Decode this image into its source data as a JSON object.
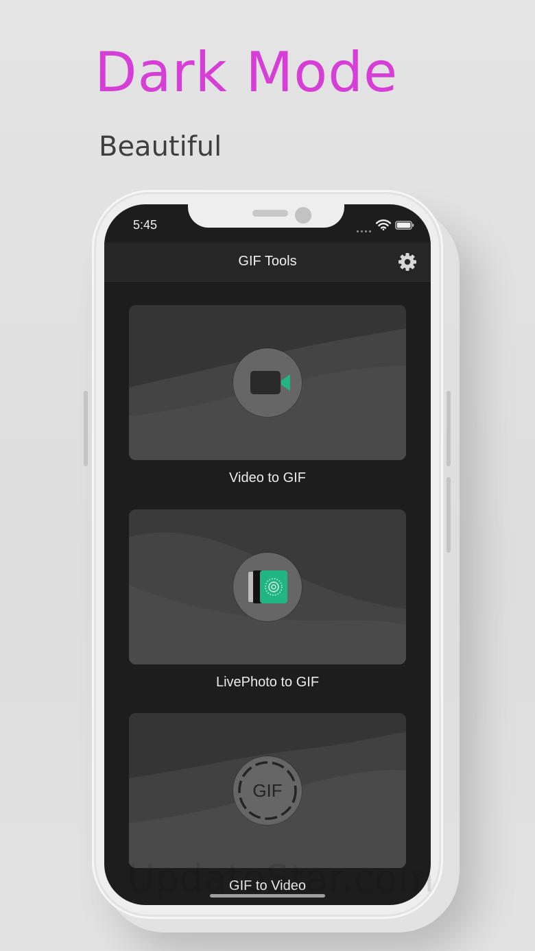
{
  "promo": {
    "headline": "Dark Mode",
    "subhead": "Beautiful"
  },
  "status_bar": {
    "time": "5:45",
    "wifi_icon": "wifi-icon",
    "battery_icon": "battery-icon"
  },
  "navbar": {
    "title": "GIF Tools",
    "settings_icon": "gear-icon"
  },
  "cards": [
    {
      "label": "Video to GIF",
      "icon": "video-camera-icon"
    },
    {
      "label": "LivePhoto to GIF",
      "icon": "live-photo-icon"
    },
    {
      "label": "GIF to Video",
      "icon": "gif-icon",
      "icon_text": "GIF"
    }
  ],
  "watermark": "UpdateStar.com",
  "colors": {
    "headline": "#d63fd6",
    "accent_green": "#22b584",
    "screen_bg": "#1d1d1d",
    "card_bg": "#3f3f3f"
  }
}
